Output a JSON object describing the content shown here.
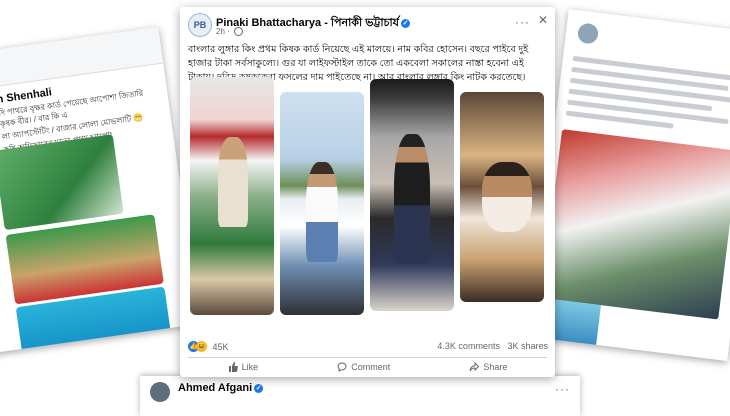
{
  "left_card": {
    "name": "h Shenhali",
    "text_lines": [
      "দি পাথরে বৃক্ষর কার্ড পেয়েছে আপোশা জিতারি কৃষক বীর। / বার কি এ",
      "লা অ্যাপস্টেটিং / বাজার লোলা মোভলাটি 😁",
      "কৃষি অফিসারের মতো প্রথম চ্যাপো!"
    ]
  },
  "main_post": {
    "author": "Pinaki Bhattacharya - পিনাকী ভট্টাচার্য",
    "avatar_text": "PB",
    "time": "2h",
    "text": "বাংলার লুঙ্গার কিং প্রথম কিষক কার্ড নিয়েছে এই মালয়ে। নাম কবির হোসেন। বছরে পাইবে দুই হাজার টাকা সর্বসাকুল্যে। গুর যা লাইফস্টাইল তাকে তো একবেলা সকালের নাস্তা হবেনা এই টাকায়। দরিদ্র কৃষককেরা ফসলের দাম পাইতেছে না। আর বাংলার লুঙ্গার কিং নাটক করতেছে।",
    "reactions_count": "45K",
    "comments": "4.3K comments",
    "shares": "3K shares",
    "actions": {
      "like": "Like",
      "comment": "Comment",
      "share": "Share"
    }
  },
  "bottom_post": {
    "author": "Ahmed Afgani"
  },
  "colors": {
    "facebook_blue": "#1877f2",
    "text": "#050505",
    "muted": "#65676b"
  }
}
